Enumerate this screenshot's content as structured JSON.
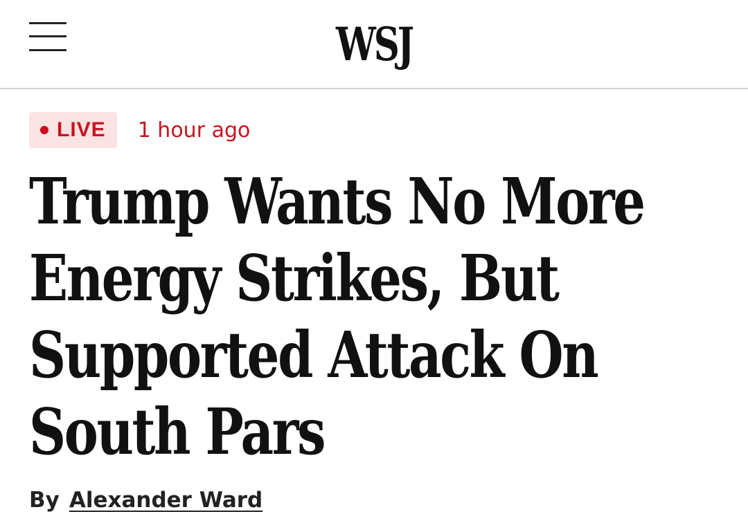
{
  "header": {
    "logo_text": "WSJ",
    "menu_icon": "hamburger-menu-icon"
  },
  "article": {
    "live_label": "LIVE",
    "live_dot_color": "#d0021b",
    "timestamp": "1 hour ago",
    "headline": "Trump Wants No More Energy Strikes, But Supported Attack On South Pars",
    "byline_prefix": "By",
    "author": "Alexander Ward"
  },
  "colors": {
    "accent_red": "#c8141e",
    "live_badge_bg": "#fbe3e3",
    "text": "#111111",
    "divider": "#d0d0d0"
  }
}
